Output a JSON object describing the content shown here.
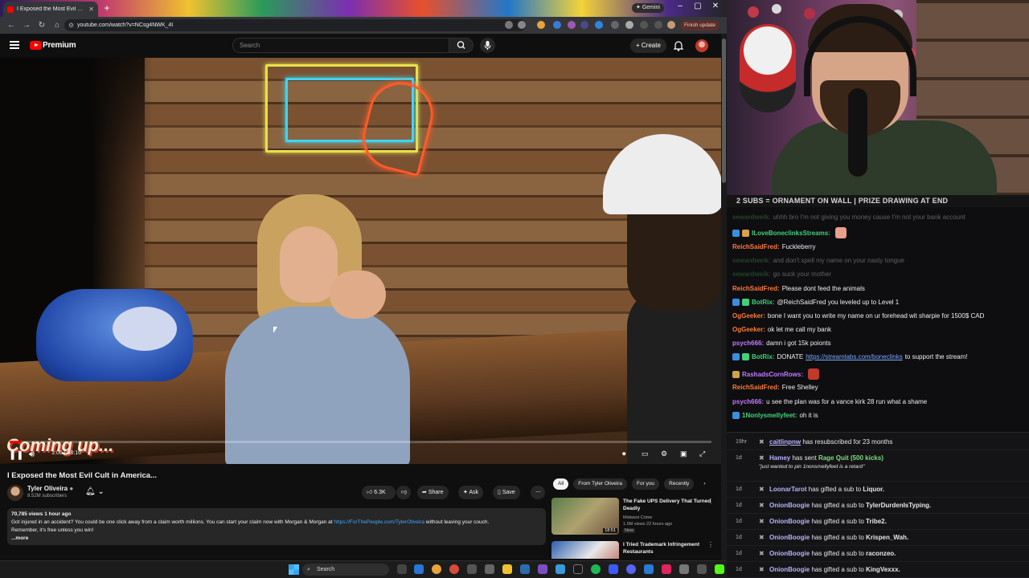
{
  "browser": {
    "tab_title": "I Exposed the Most Evil Cult",
    "url": "youtube.com/watch?v=NCsg4NWK_4I",
    "gemini_label": "Gemini",
    "finish_update_label": "Finish update"
  },
  "youtube": {
    "brand": "Premium",
    "search_placeholder": "Search",
    "create_label": "Create",
    "overlay_text": "Coming up...",
    "time_current": "1:00",
    "time_total": "58:16",
    "progress": 0.017,
    "video_title": "I Exposed the Most Evil Cult in America...",
    "channel_name": "Tyler Oliveira",
    "channel_subs": "8.52M subscribers",
    "likes": "6.3K",
    "share_label": "Share",
    "ask_label": "Ask",
    "save_label": "Save",
    "description": {
      "meta": "70,785 views  1 hour ago",
      "line1_pre": "Got injured in an accident? You could be one click away from a claim worth millions. You can start your claim now with Morgan & Morgan at ",
      "link": "https://ForThePeople.com/TylerOliveira",
      "line1_post": " without leaving your couch.",
      "line2": "Remember, it's free unless you win!",
      "more": "...more"
    },
    "chips": [
      "All",
      "From Tyler Oliveira",
      "For you",
      "Recently"
    ],
    "recommended": [
      {
        "title": "The Fake UPS Delivery That Turned Deadly",
        "channel": "Midwest Crime",
        "meta": "1.5M views  22 hours ago",
        "badge": "New",
        "duration": "18:51"
      },
      {
        "title": "I Tried Trademark Infringement Restaurants",
        "channel": "",
        "meta": "",
        "badge": "",
        "duration": ""
      }
    ]
  },
  "taskbar": {
    "search_label": "Search"
  },
  "stream": {
    "banner": "2 SUBS = ORNAMENT ON WALL | PRIZE DRAWING AT END",
    "chat": [
      {
        "user": "sewardweik:",
        "text": "uhhh bro I'm not giving you money cause I'm not your bank account",
        "color": "#4aa35a",
        "dim": true
      },
      {
        "user": "ILoveBoneclinksStreams:",
        "text": "",
        "color": "#3fd27a",
        "dim": false
      },
      {
        "user": "ReichSaidFred:",
        "text": "Fuckleberry",
        "color": "#ff7a3a",
        "dim": false
      },
      {
        "user": "sewardweik:",
        "text": "and don't spell my name on your nasty tongue",
        "color": "#4aa35a",
        "dim": true
      },
      {
        "user": "sewardweik:",
        "text": "go suck your mother",
        "color": "#4aa35a",
        "dim": true
      },
      {
        "user": "ReichSaidFred:",
        "text": "Please dont feed the animals",
        "color": "#ff7a3a",
        "dim": false
      },
      {
        "user": "BotRix:",
        "text": "@ReichSaidFred you leveled up to Level 1",
        "color": "#3fd27a",
        "dim": false
      },
      {
        "user": "OgGeeker:",
        "text": "bone I want you to write my name on ur forehead wit sharpie for 1500$ CAD",
        "color": "#ff7a3a",
        "dim": false
      },
      {
        "user": "OgGeeker:",
        "text": "ok let me call my bank",
        "color": "#ff7a3a",
        "dim": false
      },
      {
        "user": "psych666:",
        "text": "damn i got 15k poionts",
        "color": "#c27aff",
        "dim": false
      },
      {
        "user": "BotRix:",
        "text": "DONATE ",
        "link": "https://streamlabs.com/boneclinks",
        "after": " to support the stream!",
        "color": "#3fd27a",
        "dim": false
      },
      {
        "user": "RashadsCornRows:",
        "text": "",
        "color": "#c27aff",
        "dim": false
      },
      {
        "user": "ReichSaidFred:",
        "text": "Free Shelley",
        "color": "#ff7a3a",
        "dim": false
      },
      {
        "user": "psych666:",
        "text": "u see the plan was for a vance kirk 28 run what a shame",
        "color": "#c27aff",
        "dim": false
      },
      {
        "user": "1Nonlysmellyfeet:",
        "text": "oh it is",
        "color": "#3fd27a",
        "dim": false
      }
    ],
    "events": [
      {
        "age": "19hr",
        "name": "caitlinpnw",
        "text": " has resubscribed for 23 months",
        "target": "",
        "note": ""
      },
      {
        "age": "1d",
        "name": "Hamey",
        "text": " has sent ",
        "target": "Rage Quit (500 kicks)",
        "note": "\"just wanted to pin 1nonsmellyfeet is a retard\""
      },
      {
        "age": "1d",
        "name": "LoonarTarot",
        "text": " has gifted a sub to ",
        "target": "Liquor.",
        "note": ""
      },
      {
        "age": "1d",
        "name": "OnionBoogie",
        "text": " has gifted a sub to ",
        "target": "TylerDurdenIsTyping.",
        "note": ""
      },
      {
        "age": "1d",
        "name": "OnionBoogie",
        "text": " has gifted a sub to ",
        "target": "Tribe2.",
        "note": ""
      },
      {
        "age": "1d",
        "name": "OnionBoogie",
        "text": " has gifted a sub to ",
        "target": "Krispen_Wah.",
        "note": ""
      },
      {
        "age": "1d",
        "name": "OnionBoogie",
        "text": " has gifted a sub to ",
        "target": "raconzeo.",
        "note": ""
      },
      {
        "age": "1d",
        "name": "OnionBoogie",
        "text": " has gifted a sub to ",
        "target": "KingVexxx.",
        "note": ""
      }
    ]
  }
}
